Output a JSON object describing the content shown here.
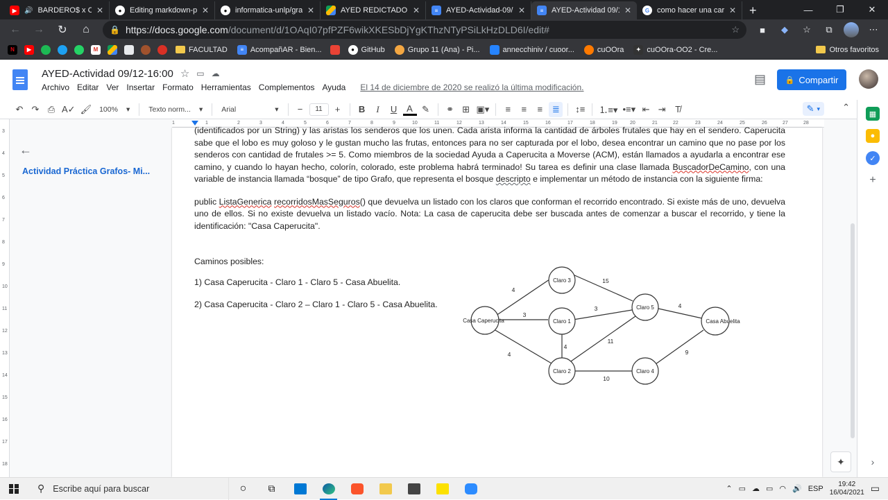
{
  "browser": {
    "tabs": [
      {
        "title": "BARDERO$ x CH",
        "favicon": "youtube",
        "color": "#ff0000",
        "active": false
      },
      {
        "title": "Editing markdown-pr",
        "favicon": "github",
        "color": "#ffffff",
        "active": false
      },
      {
        "title": "informatica-unlp/graf",
        "favicon": "github",
        "color": "#ffffff",
        "active": false
      },
      {
        "title": "AYED REDICTADO 202",
        "favicon": "drive",
        "color": "#fbbc04",
        "active": false
      },
      {
        "title": "AYED-Actividad-09/12",
        "favicon": "docs",
        "color": "#4285f4",
        "active": false
      },
      {
        "title": "AYED-Actividad 09/12",
        "favicon": "docs",
        "color": "#4285f4",
        "active": true
      },
      {
        "title": "como hacer una carp",
        "favicon": "google",
        "color": "#34a853",
        "active": false
      }
    ],
    "url_host": "https://docs.google.com",
    "url_path": "/document/d/1OAqI07pfPZF6wikXKESbDjYgKThzNTyPSiLkHzDLD6I/edit#",
    "bookmarks": [
      {
        "label": "",
        "icon": "netflix"
      },
      {
        "label": "",
        "icon": "youtube"
      },
      {
        "label": "",
        "icon": "spotify"
      },
      {
        "label": "",
        "icon": "twitter"
      },
      {
        "label": "",
        "icon": "whatsapp"
      },
      {
        "label": "",
        "icon": "gmail"
      },
      {
        "label": "",
        "icon": "drive"
      },
      {
        "label": "",
        "icon": "docs-file"
      },
      {
        "label": "",
        "icon": "spinner"
      },
      {
        "label": "",
        "icon": "circle-s"
      },
      {
        "label": "FACULTAD",
        "icon": "folder"
      },
      {
        "label": "AcompañAR - Bien...",
        "icon": "docs"
      },
      {
        "label": "",
        "icon": "image"
      },
      {
        "label": "GitHub",
        "icon": "github"
      },
      {
        "label": "Grupo 11 (Ana) - Pi...",
        "icon": "pivotal"
      },
      {
        "label": "annecchiniv / cuoor...",
        "icon": "bitbucket"
      },
      {
        "label": "cuOOra",
        "icon": "cloud"
      },
      {
        "label": "cuOOra-OO2 - Cre...",
        "icon": "pin"
      }
    ],
    "other_bookmarks": "Otros favoritos"
  },
  "docs": {
    "title": "AYED-Actividad 09/12-16:00",
    "menu": [
      "Archivo",
      "Editar",
      "Ver",
      "Insertar",
      "Formato",
      "Herramientas",
      "Complementos",
      "Ayuda"
    ],
    "last_edit": "El 14 de diciembre de 2020 se realizó la última modificación.",
    "share_label": "Compartir",
    "toolbar": {
      "zoom": "100%",
      "style": "Texto norm...",
      "font": "Arial",
      "font_size": "11"
    },
    "outline_item": "Actividad Práctica Grafos- Mi...",
    "body": {
      "p1_part1": "(identificados por un String) y las aristas los senderos que los unen. Cada arista informa la cantidad de árboles frutales que hay en el sendero. Caperucita sabe que el lobo es muy goloso y le gustan mucho las frutas, entonces para no ser capturada por el lobo, desea encontrar un camino que no pase por los senderos con cantidad de frutales >= 5. Como miembros de la sociedad Ayuda a Caperucita a Moverse (ACM), están llamados a ayudarla a encontrar ese camino, y cuando lo hayan hecho, colorín, colorado, este problema habrá terminado! Su tarea es definir una clase llamada ",
      "p1_class": "BuscadorDeCamino",
      "p1_part2": ", con una variable de instancia llamada “bosque” de tipo Grafo, que representa el bosque ",
      "p1_word": "descripto",
      "p1_part3": " e implementar un método de instancia con la siguiente firma:",
      "p2_prefix": "public ",
      "p2_type": "ListaGenerica",
      "p2_method": "recorridosMasSeguros",
      "p2_rest": "() que devuelva un listado con los claros que conforman el recorrido encontrado. Si existe más de uno, devuelva uno de ellos. Si no existe devuelva un listado vacío. Nota: La casa de caperucita debe ser buscada antes de comenzar a buscar el recorrido, y tiene la identificación: \"Casa Caperucita\".",
      "caminos_heading": "Caminos posibles:",
      "camino1": "1) Casa Caperucita - Claro 1 - Claro 5 - Casa Abuelita.",
      "camino2": "2) Casa Caperucita - Claro 2 – Claro 1 - Claro 5 - Casa Abuelita."
    },
    "graph": {
      "nodes": [
        {
          "id": "casa_caperucita",
          "label": "Casa Caperucita"
        },
        {
          "id": "claro3",
          "label": "Claro 3"
        },
        {
          "id": "claro1",
          "label": "Claro 1"
        },
        {
          "id": "claro2",
          "label": "Claro 2"
        },
        {
          "id": "claro5",
          "label": "Claro 5"
        },
        {
          "id": "claro4",
          "label": "Claro 4"
        },
        {
          "id": "casa_abuelita",
          "label": "Casa Abuelita"
        }
      ],
      "edges": [
        {
          "from": "casa_caperucita",
          "to": "claro3",
          "weight": "4"
        },
        {
          "from": "casa_caperucita",
          "to": "claro1",
          "weight": "3"
        },
        {
          "from": "casa_caperucita",
          "to": "claro2",
          "weight": "4"
        },
        {
          "from": "claro3",
          "to": "claro5",
          "weight": "15"
        },
        {
          "from": "claro1",
          "to": "claro5",
          "weight": "3"
        },
        {
          "from": "claro1",
          "to": "claro2",
          "weight": "4"
        },
        {
          "from": "claro2",
          "to": "claro5",
          "weight": "11"
        },
        {
          "from": "claro2",
          "to": "claro4",
          "weight": "10"
        },
        {
          "from": "claro5",
          "to": "casa_abuelita",
          "weight": "4"
        },
        {
          "from": "claro4",
          "to": "casa_abuelita",
          "weight": "9"
        }
      ]
    }
  },
  "taskbar": {
    "search_placeholder": "Escribe aquí para buscar",
    "language": "ESP",
    "time": "19:42",
    "date": "16/04/2021"
  }
}
